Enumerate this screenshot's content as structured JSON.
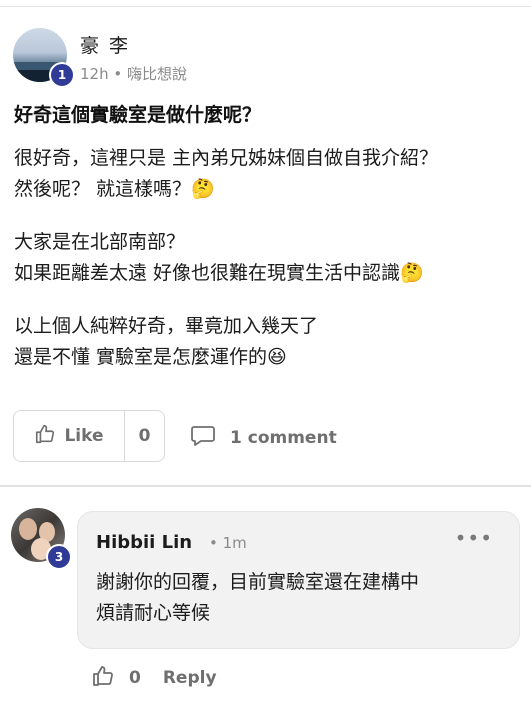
{
  "post": {
    "author": "豪 李",
    "author_badge": "1",
    "time": "12h",
    "separator": "•",
    "group": "嗨比想說",
    "title": "好奇這個實驗室是做什麼呢？",
    "paragraphs": [
      [
        "很好奇，這裡只是 主內弟兄姊妹個自做自我介紹？",
        "然後呢？ 就這樣嗎？🤔"
      ],
      [
        "大家是在北部南部？",
        "如果距離差太遠 好像也很難在現實生活中認識🤔"
      ],
      [
        "以上個人純粹好奇，畢竟加入幾天了",
        "還是不懂 實驗室是怎麼運作的😆"
      ]
    ],
    "like_label": "Like",
    "like_count": "0",
    "comment_label": "1 comment"
  },
  "comment": {
    "author": "Hibbii Lin",
    "author_badge": "3",
    "separator": "•",
    "time": "1m",
    "more": "•••",
    "lines": [
      "謝謝你的回覆，目前實驗室還在建構中",
      "煩請耐心等候"
    ],
    "like_count": "0",
    "reply_label": "Reply"
  },
  "icons": {
    "like": "thumbs-up-icon",
    "comment": "comment-bubble-icon",
    "more": "more-options-icon"
  },
  "colors": {
    "badge": "#2f3b97",
    "muted_text": "#6f6f6f",
    "bubble_bg": "#f2f2f2"
  }
}
